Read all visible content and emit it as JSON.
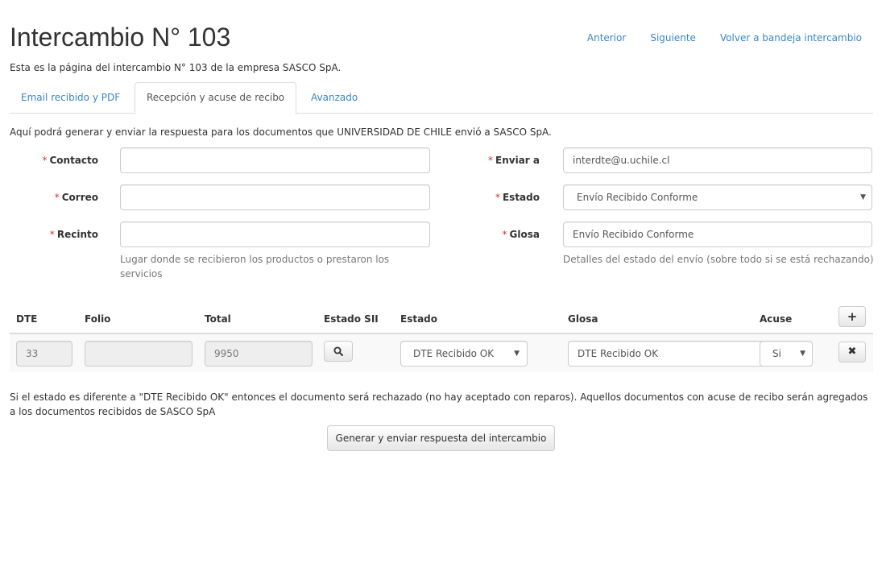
{
  "header": {
    "title": "Intercambio N° 103",
    "subtitle": "Esta es la página del intercambio N° 103 de la empresa SASCO SpA.",
    "links": {
      "previous": "Anterior",
      "next": "Siguiente",
      "back": "Volver a bandeja intercambio"
    }
  },
  "tabs": [
    {
      "label": "Email recibido y PDF",
      "active": false
    },
    {
      "label": "Recepción y acuse de recibo",
      "active": true
    },
    {
      "label": "Avanzado",
      "active": false
    }
  ],
  "intro": "Aquí podrá generar y enviar la respuesta para los documentos que UNIVERSIDAD DE CHILE envió a SASCO SpA.",
  "form": {
    "required_marker": "*",
    "contacto": {
      "label": "Contacto",
      "value": ""
    },
    "correo": {
      "label": "Correo",
      "value": ""
    },
    "recinto": {
      "label": "Recinto",
      "value": "",
      "help": "Lugar donde se recibieron los productos o prestaron los servicios"
    },
    "enviar_a": {
      "label": "Enviar a",
      "value": "interdte@u.uchile.cl"
    },
    "estado": {
      "label": "Estado",
      "value": "Envío Recibido Conforme"
    },
    "glosa": {
      "label": "Glosa",
      "value": "Envío Recibido Conforme",
      "help": "Detalles del estado del envío (sobre todo si se está rechazando)"
    }
  },
  "table": {
    "headers": {
      "dte": "DTE",
      "folio": "Folio",
      "total": "Total",
      "estado_sii": "Estado SII",
      "estado": "Estado",
      "glosa": "Glosa",
      "acuse": "Acuse"
    },
    "rows": [
      {
        "dte": "33",
        "folio": "",
        "total": "9950",
        "estado": "DTE Recibido OK",
        "glosa": "DTE Recibido OK",
        "acuse": "Si"
      }
    ]
  },
  "icons": {
    "search": "search-icon",
    "add": "plus-icon",
    "remove": "times-icon",
    "caret": "caret-down-icon"
  },
  "note": "Si el estado es diferente a \"DTE Recibido OK\" entonces el documento será rechazado (no hay aceptado con reparos). Aquellos documentos con acuse de recibo serán agregados a los documentos recibidos de SASCO SpA",
  "submit_label": "Generar y enviar respuesta del intercambio",
  "colors": {
    "link": "#3a87c5",
    "required": "#d9302c",
    "border": "#dddddd",
    "disabled_bg": "#eeeeee"
  }
}
